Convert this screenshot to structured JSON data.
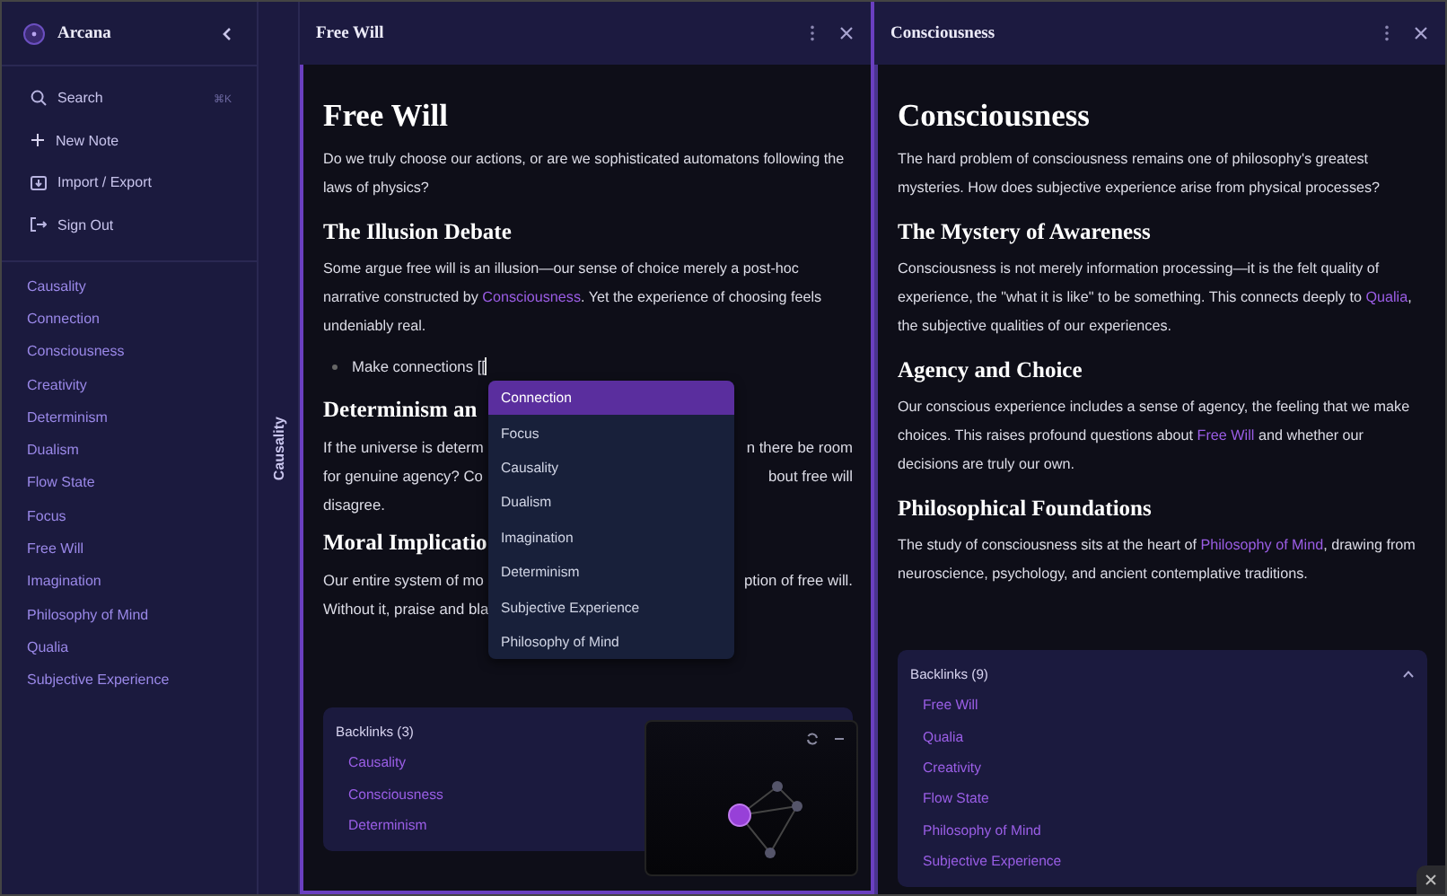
{
  "sidebar": {
    "app_name": "Arcana",
    "actions": [
      {
        "kind": "search",
        "label": "Search",
        "shortcut": "⌘K"
      },
      {
        "kind": "new",
        "label": "New Note"
      },
      {
        "kind": "import",
        "label": "Import / Export"
      },
      {
        "kind": "signout",
        "label": "Sign Out"
      }
    ],
    "notes": [
      "Causality",
      "Connection",
      "Consciousness",
      "Creativity",
      "Determinism",
      "Dualism",
      "Flow State",
      "Focus",
      "Free Will",
      "Imagination",
      "Philosophy of Mind",
      "Qualia",
      "Subjective Experience"
    ]
  },
  "collapsed_pane": {
    "title": "Causality"
  },
  "panes": [
    {
      "title": "Free Will",
      "selected": true,
      "blocks": [
        {
          "kind": "h1",
          "text": "Free Will"
        },
        {
          "kind": "p",
          "segments": [
            {
              "text": "Do we truly choose our actions, or are we sophisticated automatons following the laws of physics?"
            }
          ]
        },
        {
          "kind": "h2",
          "text": "The Illusion Debate"
        },
        {
          "kind": "p",
          "segments": [
            {
              "text": "Some argue free will is an illusion—our sense of choice merely a post-hoc narrative constructed by "
            },
            {
              "link": "Consciousness"
            },
            {
              "text": ". Yet the experience of choosing feels undeniably real."
            }
          ]
        },
        {
          "kind": "bullet",
          "text": "Make connections [[",
          "autocomplete": [
            {
              "label": "Connection",
              "selected": true
            },
            {
              "label": "Focus",
              "selected": false
            },
            {
              "label": "Causality",
              "selected": false
            },
            {
              "label": "Dualism",
              "selected": false
            },
            {
              "label": "Imagination",
              "selected": false
            },
            {
              "label": "Determinism",
              "selected": false
            },
            {
              "label": "Subjective Experience",
              "selected": false
            },
            {
              "label": "Philosophy of Mind",
              "selected": false
            }
          ]
        },
        {
          "kind": "h2",
          "text": "Determinism an"
        },
        {
          "kind": "split",
          "left": "If the universe is determ",
          "right": "n there be room"
        },
        {
          "kind": "split",
          "left": "for genuine agency? Co",
          "right": "bout free will"
        },
        {
          "kind": "split",
          "left": "disagree."
        },
        {
          "kind": "h2",
          "text": "Moral Implicatio"
        },
        {
          "kind": "split",
          "left": "Our entire system of mo",
          "right": "ption of free will."
        },
        {
          "kind": "split",
          "left": "Without it, praise and bla"
        }
      ],
      "backlinks": {
        "title": "Backlinks (3)",
        "items": [
          "Causality",
          "Consciousness",
          "Determinism"
        ]
      },
      "graph": true
    },
    {
      "title": "Consciousness",
      "selected": false,
      "blocks": [
        {
          "kind": "h1",
          "text": "Consciousness"
        },
        {
          "kind": "p",
          "segments": [
            {
              "text": "The hard problem of consciousness remains one of philosophy's greatest mysteries. How does subjective experience arise from physical processes?"
            }
          ]
        },
        {
          "kind": "h2",
          "text": "The Mystery of Awareness"
        },
        {
          "kind": "p",
          "segments": [
            {
              "text": "Consciousness is not merely information processing—it is the felt quality of experience, the \"what it is like\" to be something. This connects deeply to "
            },
            {
              "link": "Qualia"
            },
            {
              "text": ", the subjective qualities of our experiences."
            }
          ]
        },
        {
          "kind": "h2",
          "text": "Agency and Choice"
        },
        {
          "kind": "p",
          "segments": [
            {
              "text": "Our conscious experience includes a sense of agency, the feeling that we make choices. This raises profound questions about "
            },
            {
              "link": "Free Will"
            },
            {
              "text": " and whether our decisions are truly our own."
            }
          ]
        },
        {
          "kind": "h2",
          "text": "Philosophical Foundations"
        },
        {
          "kind": "p",
          "segments": [
            {
              "text": "The study of consciousness sits at the heart of "
            },
            {
              "link": "Philosophy of Mind"
            },
            {
              "text": ", drawing from neuroscience, psychology, and ancient contemplative traditions."
            }
          ]
        }
      ],
      "backlinks": {
        "title": "Backlinks (9)",
        "expanded": true,
        "items": [
          "Free Will",
          "Qualia",
          "Creativity",
          "Flow State",
          "Philosophy of Mind",
          "Subjective Experience"
        ]
      },
      "graph": false
    }
  ]
}
